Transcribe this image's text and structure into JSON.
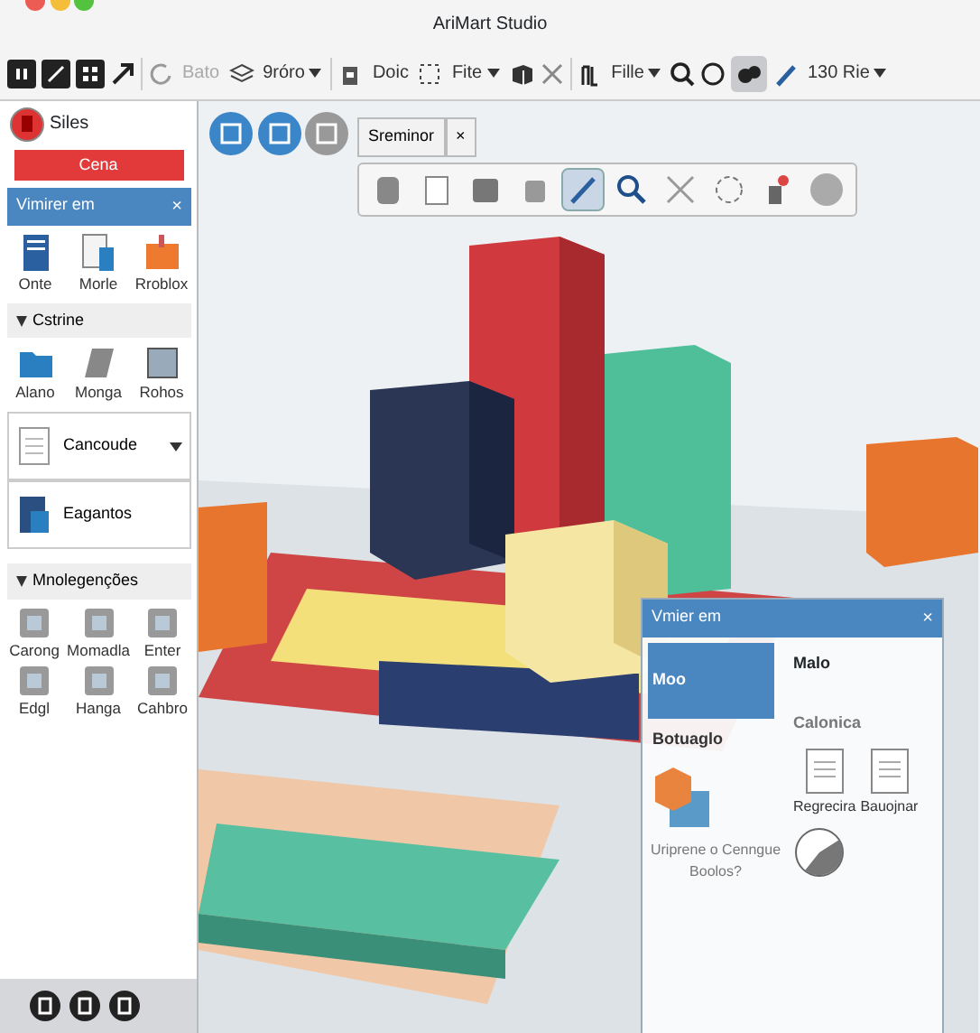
{
  "window": {
    "title": "AriMart Studio"
  },
  "toolbar": [
    {
      "label": "Bato",
      "disabled": true,
      "dropdown": false
    },
    {
      "label": "9róro",
      "disabled": false,
      "dropdown": true
    },
    {
      "label": "Doic",
      "disabled": false,
      "dropdown": false
    },
    {
      "label": "Fite",
      "disabled": false,
      "dropdown": true
    },
    {
      "label": "Fille",
      "disabled": false,
      "dropdown": true
    },
    {
      "label": "130 Rie",
      "disabled": false,
      "dropdown": true
    }
  ],
  "sidebar": {
    "user": "Siles",
    "action": "Cena",
    "panel_title": "Vimirer em",
    "close": "×",
    "items": [
      "Onte",
      "Morle",
      "Rroblox"
    ],
    "sections": [
      {
        "title": "Cstrine",
        "expanded": true,
        "items": [
          "Alano",
          "Monga",
          "Rohos"
        ]
      }
    ],
    "dropdowns": [
      "Cancoude",
      "Eagantos"
    ],
    "section2": {
      "title": "Mnolegenções",
      "expanded": true,
      "items": [
        "Carong",
        "Momadla",
        "Enter",
        "Edgl",
        "Hanga",
        "Cahbro"
      ]
    }
  },
  "viewport": {
    "tab": "Sreminor",
    "tab_close": "×",
    "tools": [
      {
        "selected": false
      },
      {
        "selected": false
      },
      {
        "selected": false
      },
      {
        "selected": false
      },
      {
        "selected": true
      },
      {
        "selected": false
      },
      {
        "selected": false
      },
      {
        "selected": false
      },
      {
        "selected": false
      },
      {
        "selected": false
      }
    ]
  },
  "dialog": {
    "title": "Vmier em",
    "close": "×",
    "left": [
      {
        "label": "Moo",
        "selected": true
      },
      {
        "label": "Botuaglo",
        "selected": false
      }
    ],
    "caption": "Uriprene o Cenngue Boolos?",
    "right_title": "Malo",
    "right_subtitle": "Calonica",
    "docs": [
      "Regrecira",
      "Bauojnar"
    ]
  }
}
